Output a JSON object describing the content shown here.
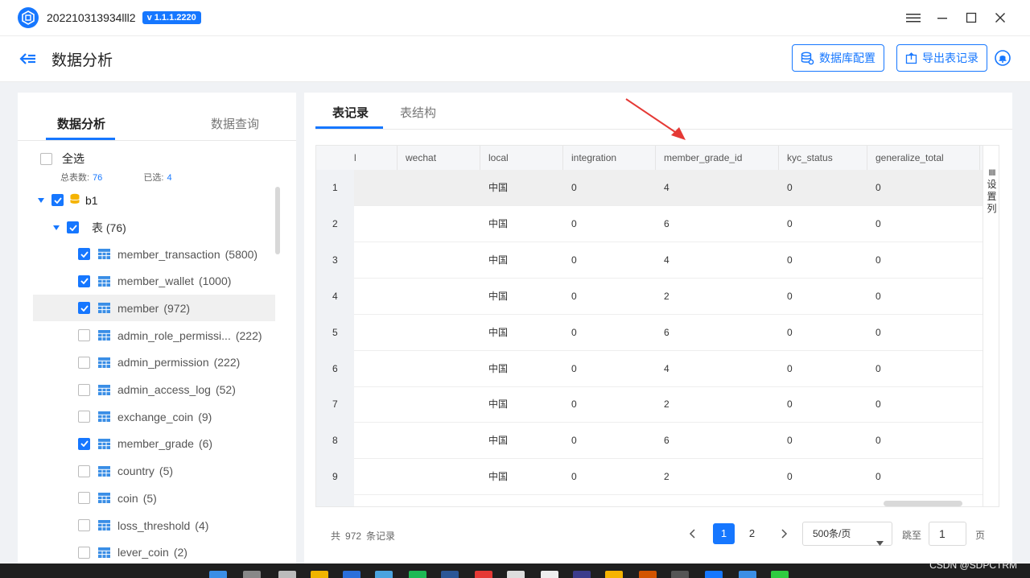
{
  "window": {
    "app_name": "202210313934lll2",
    "version": "v 1.1.1.2220"
  },
  "header": {
    "title": "数据分析",
    "db_config_label": "数据库配置",
    "export_label": "导出表记录"
  },
  "left": {
    "tab_active": "数据分析",
    "tab_inactive": "数据查询",
    "select_all": "全选",
    "total_label": "总表数:",
    "total_value": "76",
    "selected_label": "已选:",
    "selected_value": "4",
    "db_node": "b1",
    "table_group": "表 (76)",
    "tables": [
      {
        "name": "member_transaction",
        "count": "(5800)",
        "checked": true
      },
      {
        "name": "member_wallet",
        "count": "(1000)",
        "checked": true
      },
      {
        "name": "member",
        "count": "(972)",
        "checked": true,
        "selected": true
      },
      {
        "name": "admin_role_permissi...",
        "count": "(222)",
        "checked": false
      },
      {
        "name": "admin_permission",
        "count": "(222)",
        "checked": false
      },
      {
        "name": "admin_access_log",
        "count": "(52)",
        "checked": false
      },
      {
        "name": "exchange_coin",
        "count": "(9)",
        "checked": false
      },
      {
        "name": "member_grade",
        "count": "(6)",
        "checked": true
      },
      {
        "name": "country",
        "count": "(5)",
        "checked": false
      },
      {
        "name": "coin",
        "count": "(5)",
        "checked": false
      },
      {
        "name": "loss_threshold",
        "count": "(4)",
        "checked": false
      },
      {
        "name": "lever_coin",
        "count": "(2)",
        "checked": false
      }
    ]
  },
  "right": {
    "tab_active": "表记录",
    "tab_inactive": "表结构",
    "columns": [
      "l",
      "wechat",
      "local",
      "integration",
      "member_grade_id",
      "kyc_status",
      "generalize_total"
    ],
    "rows": [
      {
        "n": "1",
        "local": "中国",
        "integration": "0",
        "grade": "4",
        "kyc": "0",
        "gen": "0"
      },
      {
        "n": "2",
        "local": "中国",
        "integration": "0",
        "grade": "6",
        "kyc": "0",
        "gen": "0"
      },
      {
        "n": "3",
        "local": "中国",
        "integration": "0",
        "grade": "4",
        "kyc": "0",
        "gen": "0"
      },
      {
        "n": "4",
        "local": "中国",
        "integration": "0",
        "grade": "2",
        "kyc": "0",
        "gen": "0"
      },
      {
        "n": "5",
        "local": "中国",
        "integration": "0",
        "grade": "6",
        "kyc": "0",
        "gen": "0"
      },
      {
        "n": "6",
        "local": "中国",
        "integration": "0",
        "grade": "4",
        "kyc": "0",
        "gen": "0"
      },
      {
        "n": "7",
        "local": "中国",
        "integration": "0",
        "grade": "2",
        "kyc": "0",
        "gen": "0"
      },
      {
        "n": "8",
        "local": "中国",
        "integration": "0",
        "grade": "6",
        "kyc": "0",
        "gen": "0"
      },
      {
        "n": "9",
        "local": "中国",
        "integration": "0",
        "grade": "2",
        "kyc": "0",
        "gen": "0"
      }
    ],
    "settings_label_chars": [
      "设",
      "置",
      "列"
    ],
    "settings_bars": "IIII"
  },
  "pager": {
    "total_prefix": "共",
    "total_value": "972",
    "total_suffix": "条记录",
    "pages": [
      "1",
      "2"
    ],
    "page_size": "500条/页",
    "jump_label": "跳至",
    "jump_value": "1",
    "page_label": "页"
  },
  "watermark": "CSDN @SDPCTRM",
  "colors": {
    "accent": "#1677ff",
    "annotation": "#e53935"
  }
}
